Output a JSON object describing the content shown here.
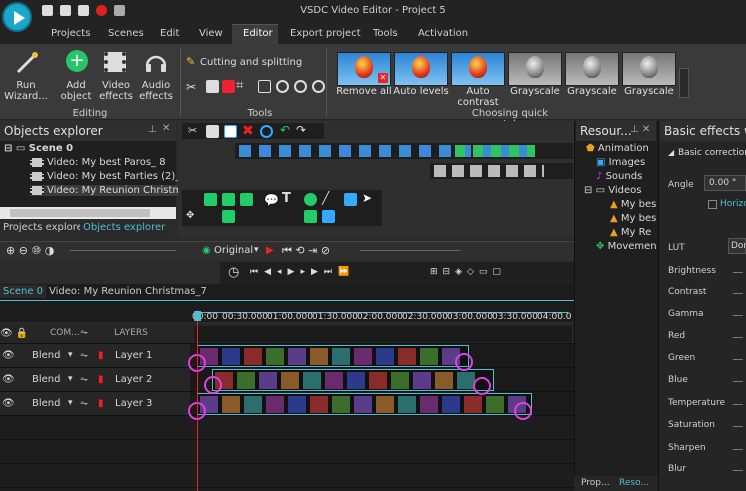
{
  "window": {
    "title": "VSDC Video Editor - Project 5"
  },
  "menu": [
    "Projects",
    "Scenes",
    "Edit",
    "View",
    "Editor",
    "Export project",
    "Tools",
    "Activation"
  ],
  "ribbon": {
    "run_wizard": "Run Wizard...",
    "add_object": "Add object",
    "video_effects": "Video effects",
    "audio_effects": "Audio effects",
    "editing_group": "Editing",
    "cutting": "Cutting and splitting",
    "tools_group": "Tools",
    "styles": [
      "Remove all",
      "Auto levels",
      "Auto contrast",
      "Grayscale",
      "Grayscale",
      "Grayscale"
    ],
    "styles_group": "Choosing quick style"
  },
  "objects_explorer": {
    "title": "Objects explorer",
    "scene": "Scene 0",
    "items": [
      "Video: My best Paros_ 8",
      "Video: My best Parties (2)_ 6",
      "Video: My Reunion Christmas_"
    ],
    "tabs": [
      "Projects explorer",
      "Objects explorer"
    ]
  },
  "preview": {
    "mode": "Original"
  },
  "timeline": {
    "tabs": [
      "Scene 0",
      "Video: My Reunion Christmas_7"
    ],
    "header": {
      "com": "COM...",
      "layers": "LAYERS"
    },
    "ticks": [
      "00:00",
      "00:30.000",
      "01:00.000",
      "01:30.000",
      "02:00.000",
      "02:30.000",
      "03:00.000",
      "03:30.000",
      "04:00.0"
    ],
    "rows": [
      {
        "blend": "Blend",
        "layer": "Layer 1"
      },
      {
        "blend": "Blend",
        "layer": "Layer 2"
      },
      {
        "blend": "Blend",
        "layer": "Layer 3"
      }
    ]
  },
  "resources": {
    "title": "Resour...",
    "items": [
      "Animation",
      "Images",
      "Sounds",
      "Videos",
      "My bes",
      "My bes",
      "My Re",
      "Movemen"
    ],
    "tabs": [
      "Prop...",
      "Reso..."
    ]
  },
  "basic_effects": {
    "title": "Basic effects wi",
    "section": "Basic correction",
    "angle_label": "Angle",
    "angle_value": "0.00 °",
    "horizontal": "Horizon",
    "lut_label": "LUT",
    "lut_value": "Don",
    "props": [
      "Brightness",
      "Contrast",
      "Gamma",
      "Red",
      "Green",
      "Blue",
      "Temperature",
      "Saturation",
      "Sharpen",
      "Blur"
    ]
  },
  "colors": {
    "accent": "#4fbfd0",
    "panel": "#1f1f1f",
    "ribbon": "#3a3a3a",
    "marker": "#e040e0"
  }
}
